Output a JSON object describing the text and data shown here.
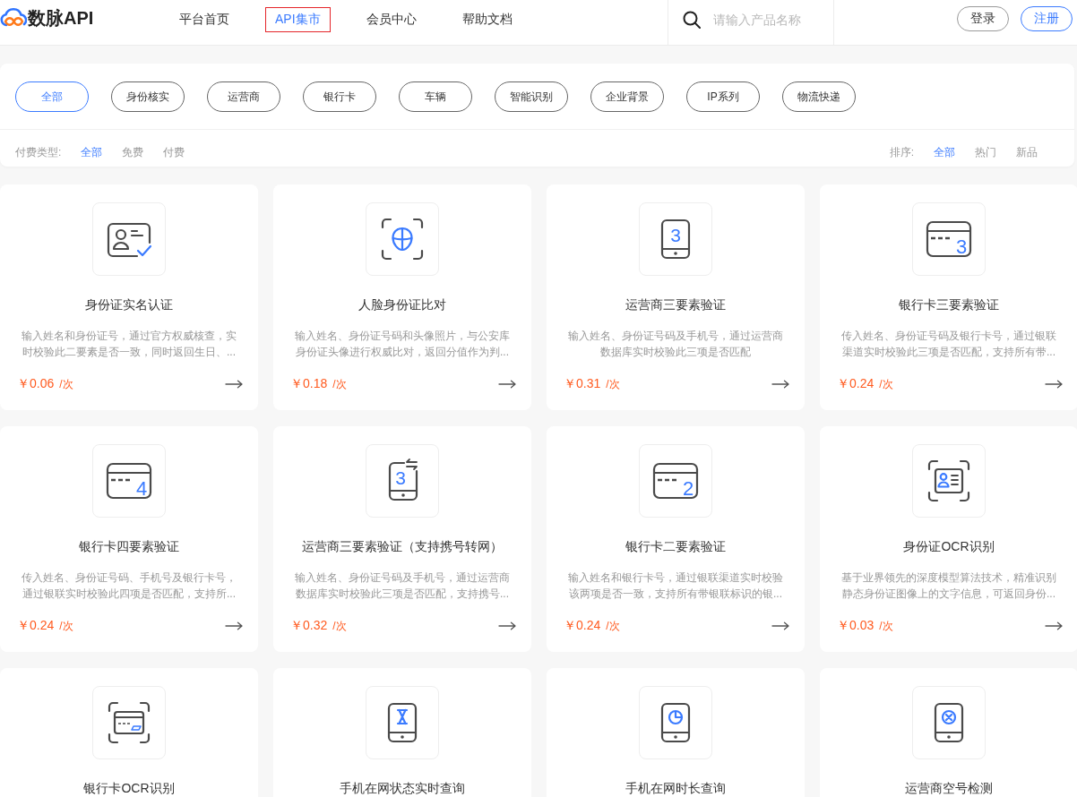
{
  "header": {
    "logo": {
      "text": "数脉API"
    },
    "nav": [
      {
        "label": "平台首页",
        "selected": false
      },
      {
        "label": "API集市",
        "selected": true
      },
      {
        "label": "会员中心",
        "selected": false
      },
      {
        "label": "帮助文档",
        "selected": false
      }
    ],
    "search": {
      "placeholder": "请输入产品名称"
    },
    "buttons": [
      {
        "label": "登录",
        "kind": "outline"
      },
      {
        "label": "注册",
        "kind": "primary"
      }
    ]
  },
  "filters": {
    "categories": [
      {
        "label": "全部",
        "selected": true
      },
      {
        "label": "身份核实",
        "selected": false
      },
      {
        "label": "运营商",
        "selected": false
      },
      {
        "label": "银行卡",
        "selected": false
      },
      {
        "label": "车辆",
        "selected": false
      },
      {
        "label": "智能识别",
        "selected": false
      },
      {
        "label": "企业背景",
        "selected": false
      },
      {
        "label": "IP系列",
        "selected": false
      },
      {
        "label": "物流快递",
        "selected": false
      }
    ],
    "pay_type": {
      "label": "付费类型:",
      "options": [
        {
          "label": "全部",
          "selected": true
        },
        {
          "label": "免费",
          "selected": false
        },
        {
          "label": "付费",
          "selected": false
        }
      ]
    },
    "sort": {
      "label": "排序:",
      "options": [
        {
          "label": "全部",
          "selected": true
        },
        {
          "label": "热门",
          "selected": false
        },
        {
          "label": "新品",
          "selected": false
        }
      ]
    }
  },
  "products": [
    {
      "title": "身份证实名认证",
      "description": "输入姓名和身份证号，通过官方权威核查，实时校验此二要素是否一致，同时返回生日、...",
      "price": "￥0.06",
      "unit": "/次",
      "icon": {
        "kind": "id-check"
      }
    },
    {
      "title": "人脸身份证比对",
      "description": "输入姓名、身份证号码和头像照片，与公安库身份证头像进行权威比对，返回分值作为判...",
      "price": "￥0.18",
      "unit": "/次",
      "icon": {
        "kind": "face-scan"
      }
    },
    {
      "title": "运营商三要素验证",
      "description": "输入姓名、身份证号码及手机号，通过运营商数据库实时校验此三项是否匹配",
      "price": "￥0.31",
      "unit": "/次",
      "icon": {
        "kind": "phone-digit",
        "digit": "3"
      }
    },
    {
      "title": "银行卡三要素验证",
      "description": "传入姓名、身份证号码及银行卡号，通过银联渠道实时校验此三项是否匹配，支持所有带...",
      "price": "￥0.24",
      "unit": "/次",
      "icon": {
        "kind": "card-digit",
        "digit": "3"
      }
    },
    {
      "title": "银行卡四要素验证",
      "description": "传入姓名、身份证号码、手机号及银行卡号，通过银联实时校验此四项是否匹配，支持所...",
      "price": "￥0.24",
      "unit": "/次",
      "icon": {
        "kind": "card-digit",
        "digit": "4"
      }
    },
    {
      "title": "运营商三要素验证（支持携号转网）",
      "description": "输入姓名、身份证号码及手机号，通过运营商数据库实时校验此三项是否匹配，支持携号...",
      "price": "￥0.32",
      "unit": "/次",
      "icon": {
        "kind": "phone-swap",
        "digit": "3"
      }
    },
    {
      "title": "银行卡二要素验证",
      "description": "输入姓名和银行卡号，通过银联渠道实时校验该两项是否一致，支持所有带银联标识的银...",
      "price": "￥0.24",
      "unit": "/次",
      "icon": {
        "kind": "card-digit",
        "digit": "2"
      }
    },
    {
      "title": "身份证OCR识别",
      "description": "基于业界领先的深度模型算法技术，精准识别静态身份证图像上的文字信息，可返回身份...",
      "price": "￥0.03",
      "unit": "/次",
      "icon": {
        "kind": "id-scan"
      }
    },
    {
      "title": "银行卡OCR识别",
      "icon": {
        "kind": "card-scan"
      }
    },
    {
      "title": "手机在网状态实时查询",
      "icon": {
        "kind": "phone-hourglass"
      }
    },
    {
      "title": "手机在网时长查询",
      "icon": {
        "kind": "phone-clock"
      }
    },
    {
      "title": "运营商空号检测",
      "icon": {
        "kind": "phone-cross"
      }
    }
  ]
}
